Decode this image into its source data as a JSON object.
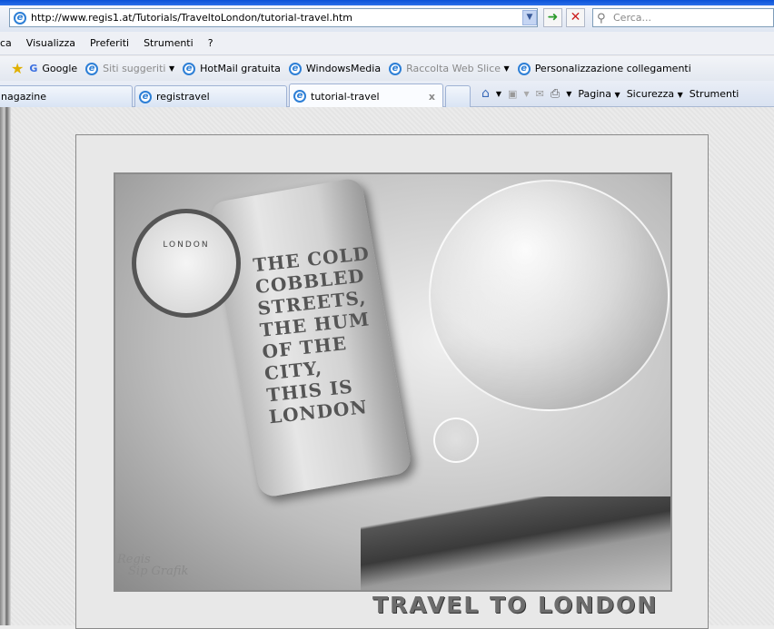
{
  "browser": {
    "address": "http://www.regis1.at/Tutorials/TraveltoLondon/tutorial-travel.htm",
    "search_placeholder": "Cerca...",
    "menu": [
      "ca",
      "Visualizza",
      "Preferiti",
      "Strumenti",
      "?"
    ],
    "links": [
      {
        "label": "Google",
        "icon": "google-icon"
      },
      {
        "label": "Siti suggeriti",
        "icon": "ie-icon",
        "dropdown": true,
        "dim": true
      },
      {
        "label": "HotMail gratuita",
        "icon": "ie-icon"
      },
      {
        "label": "WindowsMedia",
        "icon": "ie-icon"
      },
      {
        "label": "Raccolta Web Slice",
        "icon": "ie-icon",
        "dropdown": true,
        "dim": true
      },
      {
        "label": "Personalizzazione collegamenti",
        "icon": "ie-icon"
      }
    ],
    "tabs": [
      {
        "label": "nagazine"
      },
      {
        "label": "registravel"
      },
      {
        "label": "tutorial-travel",
        "active": true,
        "close": "x"
      }
    ],
    "commands": [
      "Pagina",
      "Sicurezza",
      "Strumenti"
    ]
  },
  "artwork": {
    "poem": [
      "THE COLD",
      "COBBLED",
      "STREETS,",
      "THE HUM",
      "OF THE",
      "CITY,",
      "THIS IS",
      "LONDON"
    ],
    "clock_text": "LONDON",
    "signature": [
      "Regis",
      "Sip Grafik"
    ],
    "title": "TRAVEL TO LONDON"
  }
}
